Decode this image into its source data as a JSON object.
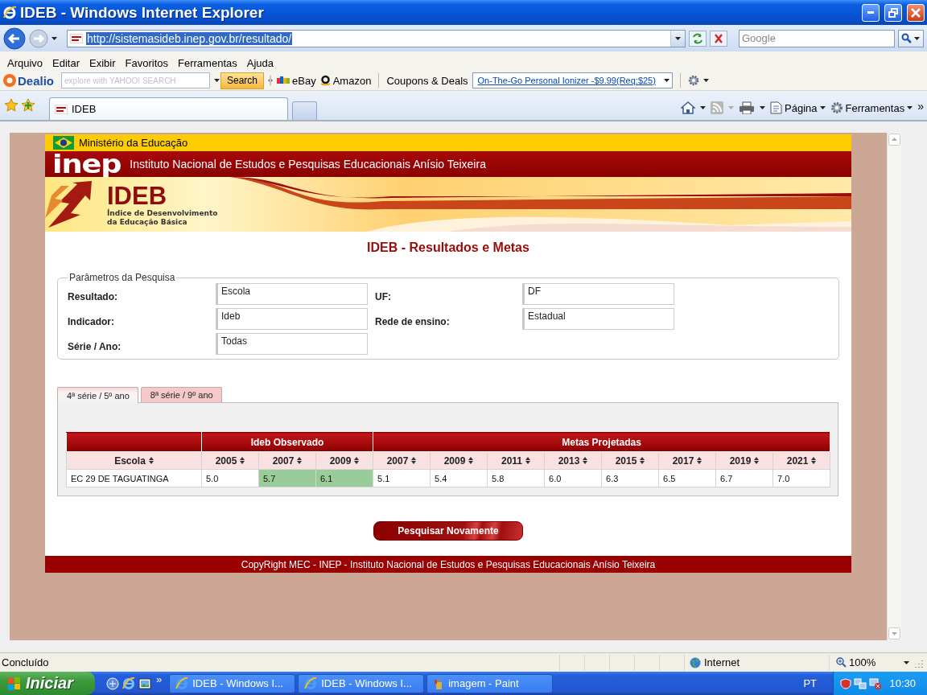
{
  "window": {
    "title": "IDEB - Windows Internet Explorer"
  },
  "address_bar": {
    "url": "http://sistemasideb.inep.gov.br/resultado/",
    "selected": true
  },
  "search_box": {
    "placeholder": "Google"
  },
  "menu": [
    "Arquivo",
    "Editar",
    "Exibir",
    "Favoritos",
    "Ferramentas",
    "Ajuda"
  ],
  "dealio_toolbar": {
    "logo": "Dealio",
    "search_placeholder": "explore with YAHOO! SEARCH",
    "search_button": "Search",
    "links": [
      "eBay",
      "Amazon",
      "Coupons & Deals"
    ],
    "offer": "On-The-Go Personal Ionizer -$9.99(Req:$25)"
  },
  "browser_tabs": [
    {
      "label": "IDEB",
      "selected": true
    }
  ],
  "command_bar": {
    "items": [
      "Página",
      "Ferramentas"
    ],
    "more": "»"
  },
  "page": {
    "ministry": "Ministério da Educação",
    "institute_logo": "inep",
    "institute": "Instituto Nacional de Estudos e Pesquisas Educacionais Anísio Teixeira",
    "banner": {
      "title": "IDEB",
      "subtitle": [
        "Índice de Desenvolvimento",
        "da Educação Básica"
      ]
    },
    "heading": "IDEB - Resultados e Metas",
    "parameters": {
      "legend": "Parâmetros da Pesquisa",
      "fields": [
        {
          "label": "Resultado:",
          "value": "Escola"
        },
        {
          "label": "UF:",
          "value": "DF"
        },
        {
          "label": "Indicador:",
          "value": "Ideb"
        },
        {
          "label": "Rede de ensino:",
          "value": "Estadual"
        },
        {
          "label": "Série / Ano:",
          "value": "Todas"
        }
      ]
    },
    "result_tabs": [
      {
        "label": "4ª série / 5º ano",
        "selected": true
      },
      {
        "label": "8ª série / 9º ano",
        "selected": false
      }
    ],
    "table": {
      "first_column": "Escola",
      "groups": [
        {
          "label": "Ideb Observado",
          "columns": [
            "2005",
            "2007",
            "2009"
          ]
        },
        {
          "label": "Metas Projetadas",
          "columns": [
            "2007",
            "2009",
            "2011",
            "2013",
            "2015",
            "2017",
            "2019",
            "2021"
          ]
        }
      ],
      "rows": [
        {
          "school": "EC 29 DE TAGUATINGA",
          "values": [
            {
              "text": "5.0",
              "highlight": false
            },
            {
              "text": "5.7",
              "highlight": true
            },
            {
              "text": "6.1",
              "highlight": true
            },
            {
              "text": "5.1",
              "highlight": false
            },
            {
              "text": "5.4",
              "highlight": false
            },
            {
              "text": "5.8",
              "highlight": false
            },
            {
              "text": "6.0",
              "highlight": false
            },
            {
              "text": "6.3",
              "highlight": false
            },
            {
              "text": "6.5",
              "highlight": false
            },
            {
              "text": "6.7",
              "highlight": false
            },
            {
              "text": "7.0",
              "highlight": false
            }
          ]
        }
      ]
    },
    "button": "Pesquisar Novamente",
    "footer": "CopyRight MEC - INEP - Instituto Nacional de Estudos e Pesquisas Educacionais Anísio Teixeira"
  },
  "status_bar": {
    "text": "Concluído",
    "zone": "Internet",
    "zoom": "100%"
  },
  "taskbar": {
    "start": "Iniciar",
    "more": "»",
    "tasks": [
      "IDEB - Windows I...",
      "IDEB - Windows I...",
      "imagem - Paint"
    ],
    "language": "PT",
    "clock": "10:30"
  }
}
